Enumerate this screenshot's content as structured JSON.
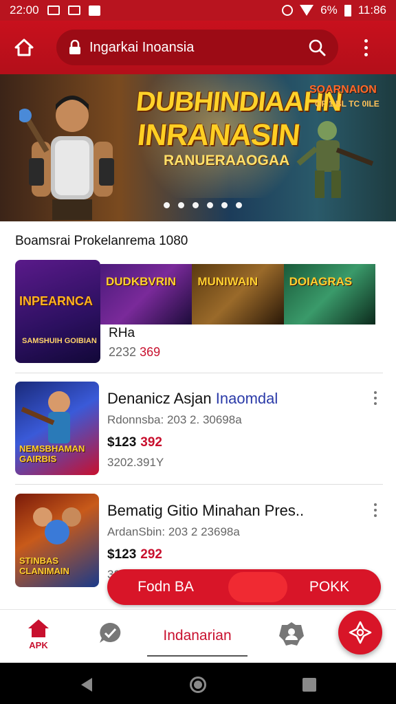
{
  "status_bar": {
    "time": "22:00",
    "battery_pct": "6%",
    "clock_right": "11:86"
  },
  "browser": {
    "url": "Ingarkai Inoansia"
  },
  "banner": {
    "title_line1": "DUBHINDIAAHN",
    "title_line2": "INRANASIN",
    "subtitle": "RANUERAAOGAA",
    "badge": "SOARNAION",
    "badge_sub": "OF 1 BL TC 0ILE",
    "slide_count": 6,
    "active_slide": 1
  },
  "section": {
    "title": "Boamsrai Prokelanrema 1080"
  },
  "featured": {
    "art_title": "INPEARNCA",
    "art_sub": "SAMSHUIH GOIBIAN",
    "tiles": [
      "DUDKBVRIN",
      "MUNIWAIN",
      "DOIAGRAS"
    ],
    "name": "RHa",
    "meta_prefix": "2232",
    "meta_accent": "369"
  },
  "apps": [
    {
      "title_main": "Denanicz Asjan",
      "title_accent": "Inaomdal",
      "sub": "Rdonnsba: 203 2. 30698a",
      "price_prefix": "$123",
      "price_accent": "392",
      "extra": "3202.391Y",
      "thumb_text": "NEMSBHAMAN GAIRBIS",
      "thumb_bg": [
        "#1a2a7a",
        "#c8102e"
      ]
    },
    {
      "title_main": "Bematig Gitio Minahan Pres..",
      "title_accent": "",
      "sub": "ArdanSbin: 203 2 23698a",
      "price_prefix": "$123",
      "price_accent": "292",
      "extra": "3201.0101",
      "thumb_text": "STINBAS CLANIMAIN",
      "thumb_bg": [
        "#7a1a0a",
        "#1a3a8a"
      ]
    }
  ],
  "action_pill": {
    "left_label": "Fodn BA",
    "right_label": "POKK"
  },
  "bottom_nav": {
    "home_label": "APK",
    "center_label": "Indanarian"
  },
  "colors": {
    "brand_red": "#c8102e",
    "status_bar": "#b8141f",
    "accent_blue": "#2a3aa8"
  }
}
